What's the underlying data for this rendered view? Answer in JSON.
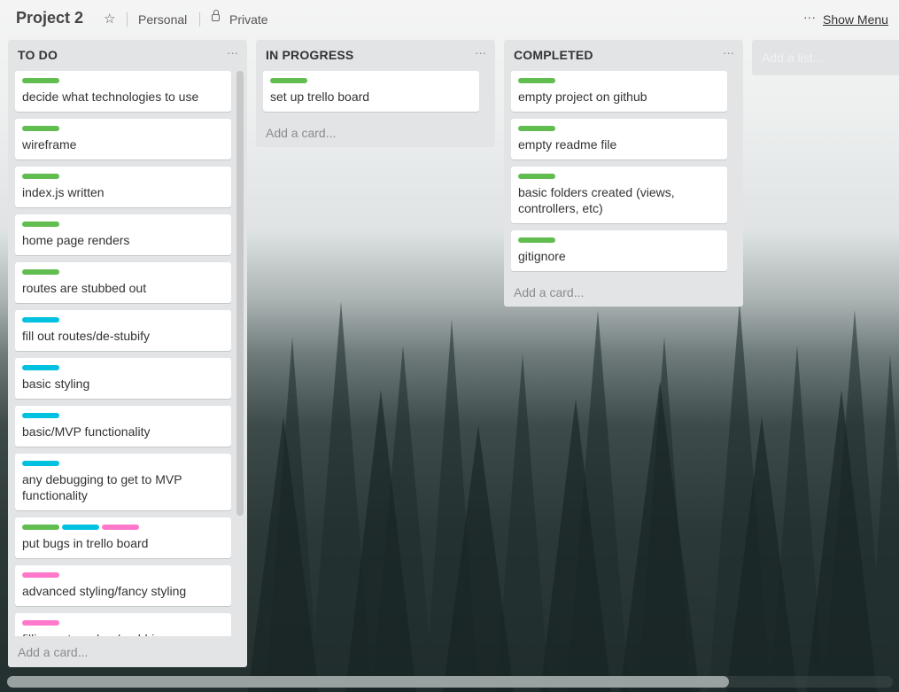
{
  "board": {
    "title": "Project 2",
    "team": "Personal",
    "visibility": "Private",
    "menu_dots": "···",
    "show_menu": "Show Menu"
  },
  "colors": {
    "green": "#61bd4f",
    "blue": "#00c2e0",
    "pink": "#ff78cb"
  },
  "icons": {
    "star": "star-icon",
    "lock": "lock-icon",
    "list_menu": "more-icon"
  },
  "lists": [
    {
      "title": "TO DO",
      "menu": "···",
      "add_card": "Add a card...",
      "cards": [
        {
          "labels": [
            "green"
          ],
          "text": "decide what technologies to use"
        },
        {
          "labels": [
            "green"
          ],
          "text": "wireframe"
        },
        {
          "labels": [
            "green"
          ],
          "text": "index.js written"
        },
        {
          "labels": [
            "green"
          ],
          "text": "home page renders"
        },
        {
          "labels": [
            "green"
          ],
          "text": "routes are stubbed out"
        },
        {
          "labels": [
            "blue"
          ],
          "text": "fill out routes/de-stubify"
        },
        {
          "labels": [
            "blue"
          ],
          "text": "basic styling"
        },
        {
          "labels": [
            "blue"
          ],
          "text": "basic/MVP functionality"
        },
        {
          "labels": [
            "blue"
          ],
          "text": "any debugging to get to MVP functionality"
        },
        {
          "labels": [
            "green",
            "blue",
            "pink"
          ],
          "text": "put bugs in trello board"
        },
        {
          "labels": [
            "pink"
          ],
          "text": "advanced styling/fancy styling"
        },
        {
          "labels": [
            "pink"
          ],
          "text": "filling out readme/grabbing"
        }
      ]
    },
    {
      "title": "IN PROGRESS",
      "menu": "···",
      "add_card": "Add a card...",
      "cards": [
        {
          "labels": [
            "green"
          ],
          "text": "set up trello board"
        }
      ]
    },
    {
      "title": "COMPLETED",
      "menu": "···",
      "add_card": "Add a card...",
      "cards": [
        {
          "labels": [
            "green"
          ],
          "text": "empty project on github"
        },
        {
          "labels": [
            "green"
          ],
          "text": "empty readme file"
        },
        {
          "labels": [
            "green"
          ],
          "text": "basic folders created (views, controllers, etc)"
        },
        {
          "labels": [
            "green"
          ],
          "text": "gitignore"
        }
      ]
    }
  ],
  "add_list": "Add a list..."
}
